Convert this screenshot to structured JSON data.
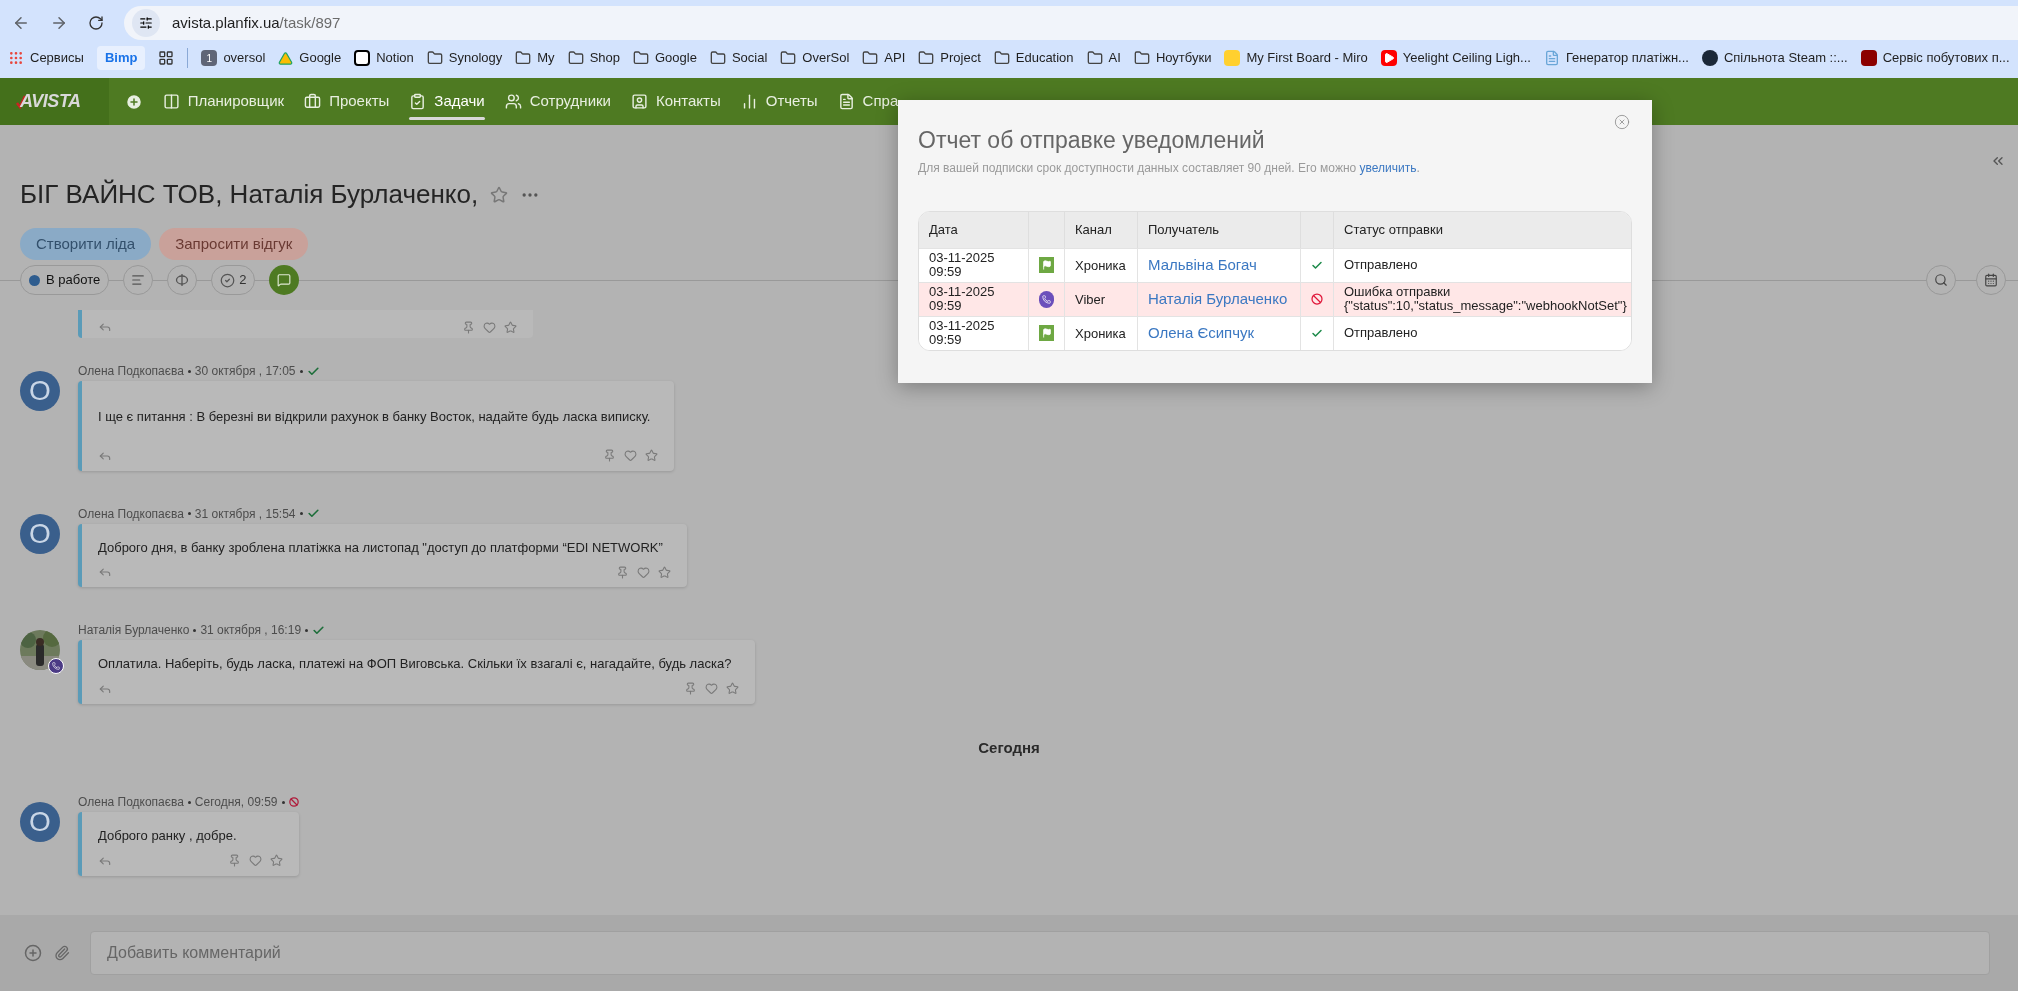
{
  "browser": {
    "url_host": "avista.planfix.ua",
    "url_path": "/task/897",
    "bookmarks": [
      {
        "kind": "apps",
        "label": "Сервисы"
      },
      {
        "kind": "chip",
        "label": "Bimp"
      },
      {
        "kind": "grid"
      },
      {
        "kind": "badge",
        "badge": "1",
        "label": "oversol"
      },
      {
        "kind": "drive",
        "label": "Google"
      },
      {
        "kind": "notion",
        "label": "Notion"
      },
      {
        "kind": "folder",
        "label": "Synology"
      },
      {
        "kind": "folder",
        "label": "My"
      },
      {
        "kind": "folder",
        "label": "Shop"
      },
      {
        "kind": "folder",
        "label": "Google"
      },
      {
        "kind": "folder",
        "label": "Social"
      },
      {
        "kind": "folder",
        "label": "OverSol"
      },
      {
        "kind": "folder",
        "label": "API"
      },
      {
        "kind": "folder",
        "label": "Project"
      },
      {
        "kind": "folder",
        "label": "Education"
      },
      {
        "kind": "folder",
        "label": "AI"
      },
      {
        "kind": "folder",
        "label": "Ноутбуки"
      },
      {
        "kind": "miro",
        "label": "My First Board - Miro"
      },
      {
        "kind": "youtube",
        "label": "Yeelight Ceiling Ligh..."
      },
      {
        "kind": "doc",
        "label": "Генератор платіжн..."
      },
      {
        "kind": "steam",
        "label": "Спільнота Steam ::..."
      },
      {
        "kind": "service",
        "label": "Сервіс побутових п..."
      }
    ]
  },
  "nav": {
    "logo": "AVISTA",
    "items": [
      {
        "label": "Планировщик",
        "selected": false
      },
      {
        "label": "Проекты",
        "selected": false
      },
      {
        "label": "Задачи",
        "selected": true
      },
      {
        "label": "Сотрудники",
        "selected": false
      },
      {
        "label": "Контакты",
        "selected": false
      },
      {
        "label": "Отчеты",
        "selected": false
      },
      {
        "label": "Спра",
        "selected": false
      }
    ]
  },
  "task": {
    "title": "БІГ ВАЙНС ТОВ, Наталія Бурлаченко,",
    "actions": [
      {
        "kind": "blue",
        "label": "Створити ліда"
      },
      {
        "kind": "red",
        "label": "Запросити відгук"
      }
    ],
    "status": {
      "label": "В работе",
      "color": "#2f5d8f"
    },
    "checklist_count": "2"
  },
  "feed": [
    {
      "kind": "clipped"
    },
    {
      "kind": "comment",
      "avatar": {
        "kind": "initial",
        "initial": "O"
      },
      "author": "Олена Подкопаєва",
      "date": "30 октября , 17:05",
      "delivered": true,
      "text": "І ще є питання :  В березні ви відкрили рахунок в банку Восток,  надайте будь ласка  виписку.",
      "tall": true
    },
    {
      "kind": "comment",
      "avatar": {
        "kind": "initial",
        "initial": "O"
      },
      "author": "Олена Подкопаєва",
      "date": "31 октября , 15:54",
      "delivered": true,
      "text": "Доброго дня, в банку зроблена платіжка на листопад \"доступ до платформи “EDI NETWORK”",
      "tall": false
    },
    {
      "kind": "comment",
      "author": "Наталія Бурлаченко",
      "date": "31 октября , 16:19",
      "delivered": true,
      "text": "Оплатила. Наберіть, будь ласка, платежі на ФОП Виговська. Скільки їх взагалі є, нагадайте, будь ласка?",
      "tall": false
    },
    {
      "kind": "day",
      "label": "Сегодня"
    },
    {
      "kind": "comment",
      "avatar": {
        "kind": "initial",
        "initial": "O"
      },
      "author": "Олена Подкопаєва",
      "date": "Сегодня, 09:59",
      "delivered": false,
      "text": "Доброго ранку , добре.",
      "tall": false
    }
  ],
  "composer": {
    "placeholder": "Добавить комментарий"
  },
  "modal": {
    "title": "Отчет об отправке уведомлений",
    "note": "Для вашей подписки срок доступности данных составляет 90 дней. Его можно ",
    "link": "увеличить",
    "note_end": ".",
    "columns": [
      "Дата",
      "Канал",
      "Получатель",
      "Статус отправки"
    ],
    "rows": [
      {
        "kind": "chronicle",
        "date": "03-11-2025",
        "time": "09:59",
        "channel": "Хроника",
        "recipient": "Мальвіна Богач",
        "failed": false,
        "status": "Отправлено"
      },
      {
        "kind": "viber",
        "date": "03-11-2025",
        "time": "09:59",
        "channel": "Viber",
        "recipient": "Наталія Бурлаченко",
        "failed": true,
        "status": "Ошибка отправки",
        "detail": "{\"status\":10,\"status_message\":\"webhookNotSet\"}"
      },
      {
        "kind": "chronicle",
        "date": "03-11-2025",
        "time": "09:59",
        "channel": "Хроника",
        "recipient": "Олена Єсипчук",
        "failed": false,
        "status": "Отправлено"
      }
    ]
  }
}
